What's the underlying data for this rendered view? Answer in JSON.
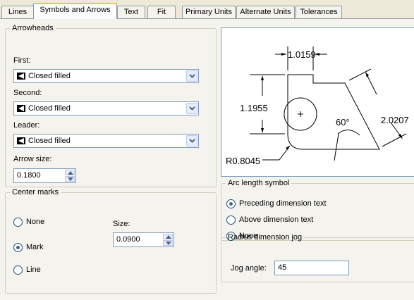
{
  "tabs": [
    {
      "label": "Lines"
    },
    {
      "label": "Symbols and Arrows"
    },
    {
      "label": "Text"
    },
    {
      "label": "Fit"
    },
    {
      "label": "Primary Units"
    },
    {
      "label": "Alternate Units"
    },
    {
      "label": "Tolerances"
    }
  ],
  "active_tab": "Symbols and Arrows",
  "arrowheads": {
    "legend": "Arrowheads",
    "first_label": "First:",
    "first_value": "Closed filled",
    "second_label": "Second:",
    "second_value": "Closed filled",
    "leader_label": "Leader:",
    "leader_value": "Closed filled",
    "arrow_size_label": "Arrow size:",
    "arrow_size_value": "0.1800"
  },
  "center_marks": {
    "legend": "Center marks",
    "options": [
      "None",
      "Mark",
      "Line"
    ],
    "selected": "Mark",
    "size_label": "Size:",
    "size_value": "0.0900"
  },
  "preview": {
    "dim_top": "1.0159",
    "dim_left": "1.1955",
    "dim_right": "2.0207",
    "angle": "60°",
    "radius": "R0.8045"
  },
  "arc_length_symbol": {
    "legend": "Arc length symbol",
    "options": [
      "Preceding dimension text",
      "Above dimension text",
      "None"
    ],
    "selected": "Preceding dimension text"
  },
  "radius_jog": {
    "legend": "Radius dimension jog",
    "jog_label": "Jog angle:",
    "jog_value": "45"
  },
  "colors": {
    "panel_bg": "#f4f3ee",
    "active_tab_accent": "#ffc83c",
    "input_border": "#7f9db9"
  }
}
